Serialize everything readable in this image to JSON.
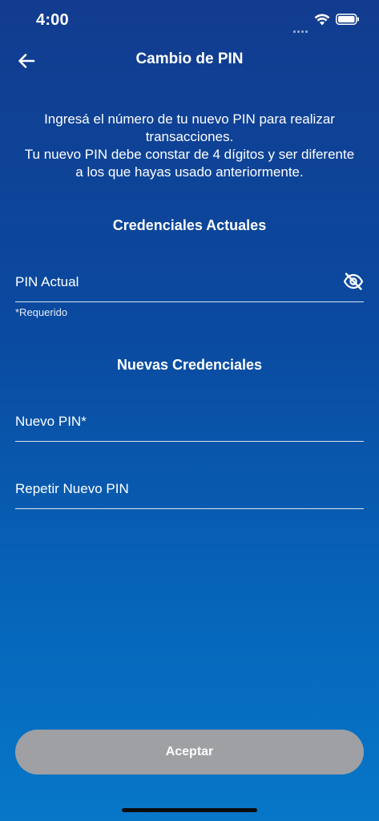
{
  "status_bar": {
    "time": "4:00"
  },
  "header": {
    "title": "Cambio de PIN",
    "back_icon": "arrow-left-icon"
  },
  "instructions": {
    "line1": "Ingresá el número de tu nuevo PIN para realizar transacciones.",
    "line2": "Tu nuevo PIN debe constar de 4 dígitos y ser diferente a los que hayas usado anteriormente."
  },
  "current_credentials": {
    "title": "Credenciales Actuales",
    "pin_field": {
      "placeholder": "PIN Actual",
      "value": "",
      "visibility_icon": "eye-off-icon"
    },
    "helper": "*Requerido"
  },
  "new_credentials": {
    "title": "Nuevas Credenciales",
    "new_pin_field": {
      "placeholder": "Nuevo PIN*",
      "value": ""
    },
    "repeat_pin_field": {
      "placeholder": "Repetir Nuevo PIN",
      "value": ""
    }
  },
  "actions": {
    "accept_label": "Aceptar"
  },
  "colors": {
    "background_top": "#123c8f",
    "background_bottom": "#0777c8",
    "button_disabled": "#9ea0a3",
    "text": "#ffffff"
  }
}
